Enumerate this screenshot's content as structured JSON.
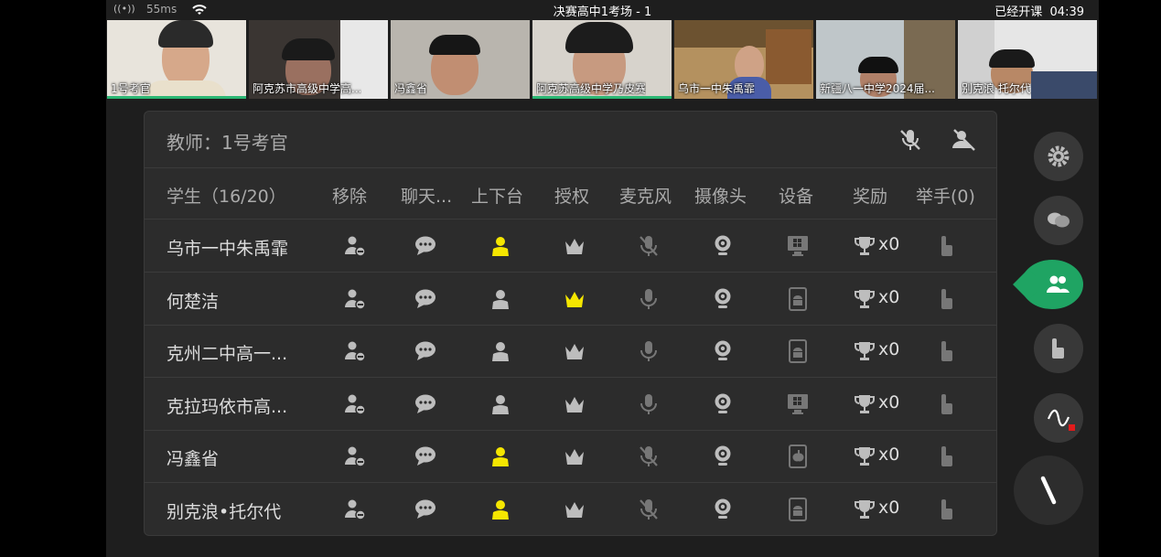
{
  "status": {
    "signal": "((•))",
    "ping": "55ms",
    "title": "决赛高中1考场 - 1",
    "class_status": "已经开课",
    "time": "04:39"
  },
  "videos": [
    {
      "name": "1号考官"
    },
    {
      "name": "阿克苏市高级中学高..."
    },
    {
      "name": "冯鑫省"
    },
    {
      "name": "阿克苏高级中学乃皮赛"
    },
    {
      "name": "乌市一中朱禹霏"
    },
    {
      "name": "新疆八一中学2024届..."
    },
    {
      "name": "别克浪·托尔代"
    }
  ],
  "panel": {
    "title": "教师：1号考官",
    "columns": [
      "学生（16/20）",
      "移除",
      "聊天...",
      "上下台",
      "授权",
      "麦克风",
      "摄像头",
      "设备",
      "奖励",
      "举手(0)"
    ],
    "students": [
      {
        "name": "乌市一中朱禹霏",
        "on_stage": true,
        "authorized": false,
        "mic_muted": true,
        "device": "windows-icon",
        "reward": "x0"
      },
      {
        "name": "何楚洁",
        "on_stage": false,
        "authorized": true,
        "mic_muted": false,
        "device": "android-icon",
        "reward": "x0"
      },
      {
        "name": "克州二中高一...",
        "on_stage": false,
        "authorized": false,
        "mic_muted": false,
        "device": "android-icon",
        "reward": "x0"
      },
      {
        "name": "克拉玛依市高...",
        "on_stage": false,
        "authorized": false,
        "mic_muted": false,
        "device": "windows-icon",
        "reward": "x0"
      },
      {
        "name": "冯鑫省",
        "on_stage": true,
        "authorized": false,
        "mic_muted": true,
        "device": "apple-icon",
        "reward": "x0"
      },
      {
        "name": "别克浪•托尔代",
        "on_stage": true,
        "authorized": false,
        "mic_muted": true,
        "device": "android-icon",
        "reward": "x0"
      }
    ]
  },
  "colors": {
    "on_stage": "#f5e600",
    "authorized": "#f5e600",
    "active_tab": "#1fa463",
    "icon": "#bdbdbd",
    "icon_dim": "#777777"
  }
}
